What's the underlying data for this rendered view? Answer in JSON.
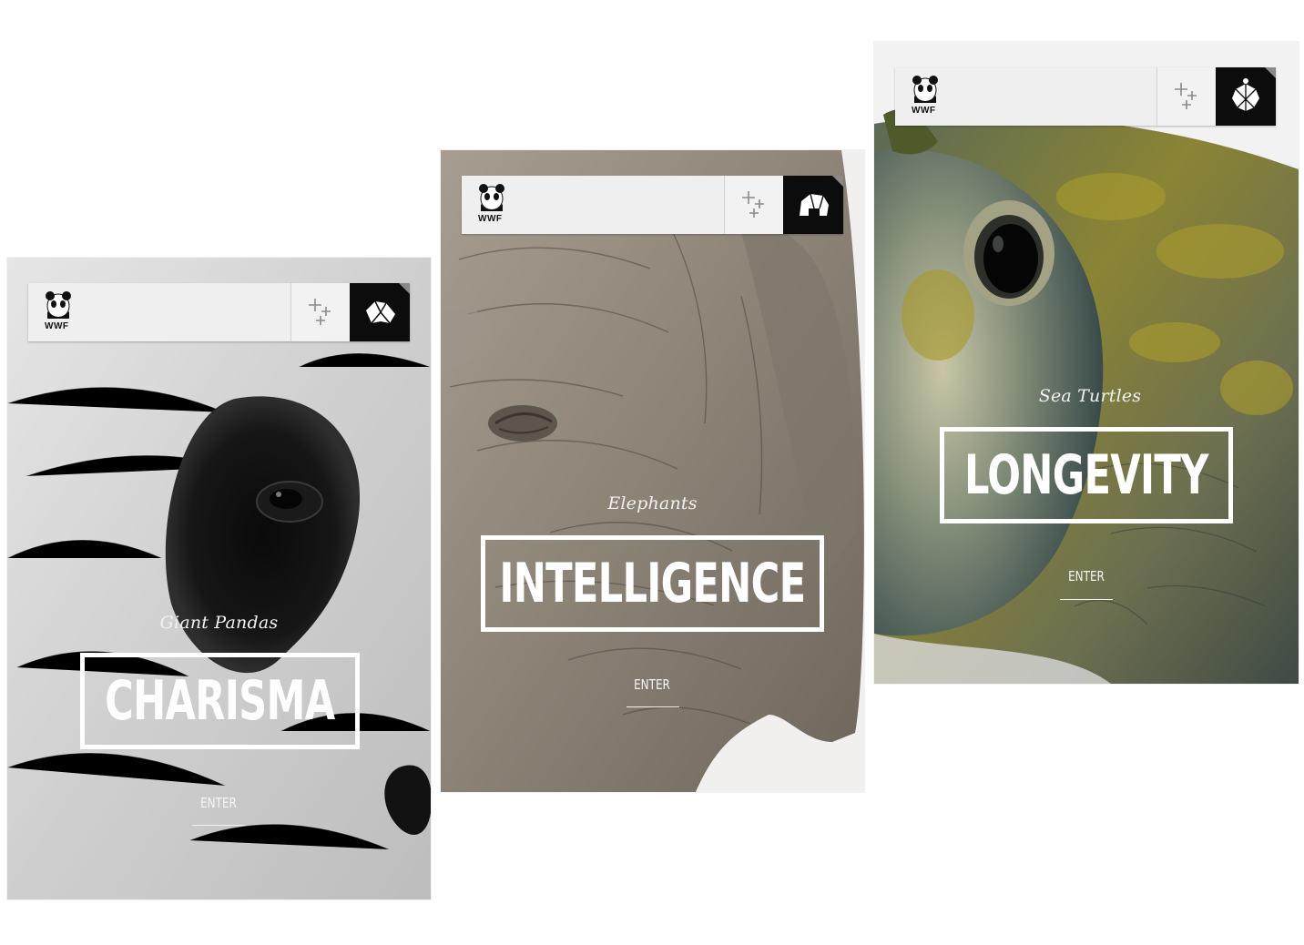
{
  "brand": {
    "logo_text": "WWF",
    "accent": "#0c0c0c",
    "bar_color": "#efefef"
  },
  "cards": [
    {
      "animal": "Giant Pandas",
      "trait": "CHARISMA",
      "enter_label": "ENTER",
      "icon": "panda-origami-icon"
    },
    {
      "animal": "Elephants",
      "trait": "INTELLIGENCE",
      "enter_label": "ENTER",
      "icon": "elephant-origami-icon"
    },
    {
      "animal": "Sea Turtles",
      "trait": "LONGEVITY",
      "enter_label": "ENTER",
      "icon": "turtle-origami-icon"
    }
  ],
  "icons": {
    "plus": "plus-cluster-icon",
    "logo": "wwf-panda-logo-icon"
  }
}
